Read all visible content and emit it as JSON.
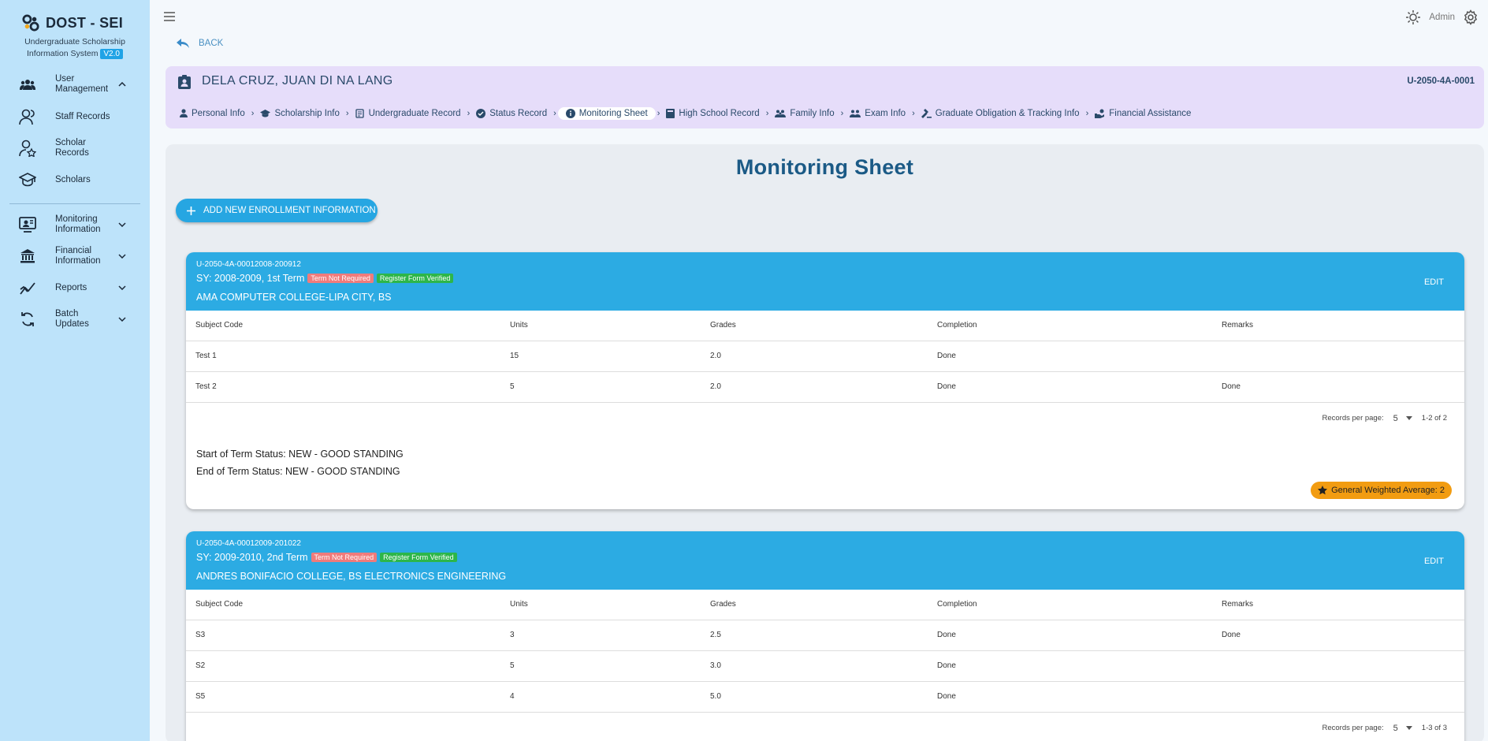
{
  "brand": {
    "title": "DOST - SEI",
    "subtitle_line1": "Undergraduate Scholarship",
    "subtitle_line2": "Information System",
    "version": "V2.0"
  },
  "sidebar": {
    "items": [
      {
        "label": "User Management",
        "icon": "users-icon",
        "expanded": true
      },
      {
        "label": "Staff Records",
        "icon": "staff-icon"
      },
      {
        "label": "Scholar Records",
        "icon": "scholar-record-icon"
      },
      {
        "label": "Scholars",
        "icon": "graduation-cap-icon"
      },
      {
        "label": "Monitoring Information",
        "icon": "monitor-icon"
      },
      {
        "label": "Financial Information",
        "icon": "bank-icon"
      },
      {
        "label": "Reports",
        "icon": "chart-icon"
      },
      {
        "label": "Batch Updates",
        "icon": "sync-icon"
      }
    ]
  },
  "topbar": {
    "user": "Admin"
  },
  "back_label": "BACK",
  "header": {
    "name": "DELA CRUZ, JUAN DI NA LANG",
    "code": "U-2050-4A-0001",
    "tabs": [
      {
        "label": "Personal Info",
        "icon": "person-icon"
      },
      {
        "label": "Scholarship Info",
        "icon": "school-icon"
      },
      {
        "label": "Undergraduate Record",
        "icon": "record-icon"
      },
      {
        "label": "Status Record",
        "icon": "check-circle-icon"
      },
      {
        "label": "Monitoring Sheet",
        "icon": "info-icon",
        "active": true
      },
      {
        "label": "High School Record",
        "icon": "book-icon"
      },
      {
        "label": "Family Info",
        "icon": "family-icon"
      },
      {
        "label": "Exam Info",
        "icon": "exam-icon"
      },
      {
        "label": "Graduate Obligation & Tracking Info",
        "icon": "gavel-icon"
      },
      {
        "label": "Financial Assistance",
        "icon": "finance-icon"
      }
    ]
  },
  "main": {
    "title": "Monitoring Sheet",
    "add_button": "ADD NEW ENROLLMENT INFORMATION",
    "columns": [
      "Subject Code",
      "Units",
      "Grades",
      "Completion",
      "Remarks"
    ],
    "records_per_page_label": "Records per page:",
    "edit_label": "EDIT",
    "badges": {
      "term": "Term Not Required",
      "register": "Register Form Verified"
    },
    "enrollments": [
      {
        "code": "U-2050-4A-00012008-200912",
        "sy": "SY: 2008-2009, 1st Term",
        "school": "AMA COMPUTER COLLEGE-LIPA CITY, BS",
        "rows": [
          [
            "Test 1",
            "15",
            "2.0",
            "Done",
            ""
          ],
          [
            "Test 2",
            "5",
            "2.0",
            "Done",
            "Done"
          ]
        ],
        "per_page": "5",
        "range": "1-2 of 2",
        "start_status": "Start of Term Status: NEW - GOOD STANDING",
        "end_status": "End of Term Status: NEW - GOOD STANDING",
        "gwa": "General Weighted Average: 2"
      },
      {
        "code": "U-2050-4A-00012009-201022",
        "sy": "SY: 2009-2010, 2nd Term",
        "school": "ANDRES BONIFACIO COLLEGE, BS ELECTRONICS ENGINEERING",
        "rows": [
          [
            "S3",
            "3",
            "2.5",
            "Done",
            "Done"
          ],
          [
            "S2",
            "5",
            "3.0",
            "Done",
            ""
          ],
          [
            "S5",
            "4",
            "5.0",
            "Done",
            ""
          ]
        ],
        "per_page": "5",
        "range": "1-3 of 3"
      }
    ]
  },
  "colors": {
    "sidebar_bg": "#bde3fa",
    "header_bg": "#e6ddfa",
    "card_head": "#2cabe3",
    "accent": "#26a6e2",
    "gwa_badge": "#f29c11",
    "badge_red": "#f07b7b",
    "badge_green": "#2db64a"
  }
}
